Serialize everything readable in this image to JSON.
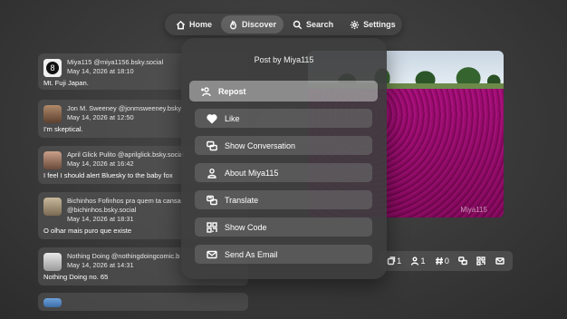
{
  "nav": {
    "items": [
      {
        "label": "Home",
        "icon": "home-icon"
      },
      {
        "label": "Discover",
        "icon": "discover-icon"
      },
      {
        "label": "Search",
        "icon": "search-icon"
      },
      {
        "label": "Settings",
        "icon": "gear-icon"
      }
    ],
    "active": "Discover"
  },
  "feed": {
    "posts": [
      {
        "author": "Miya115 @miya1156.bsky.social",
        "date": "May 14, 2026 at 18:10",
        "text": "Mt. Fuji  Japan."
      },
      {
        "author": "Jon M. Sweeney @jonmsweeney.bsky.",
        "date": "May 14, 2026 at 12:50",
        "text": "I'm skeptical."
      },
      {
        "author": "April Glick Pulito @aprilglick.bsky.social",
        "date": "May 14, 2026 at 16:42",
        "text": "I feel I should alert Bluesky to the baby fox"
      },
      {
        "author": "Bichinhos Fofinhos pra quem ta cansa",
        "handle": "@bichinhos.bsky.social",
        "date": "May 14, 2026 at 18:31",
        "text": "O olhar mais puro que existe"
      },
      {
        "author": "Nothing Doing @nothingdoingcomic.b",
        "date": "May 14, 2026 at 14:31",
        "text": "Nothing Doing no. 65"
      }
    ]
  },
  "photo": {
    "caption": "Miya115"
  },
  "actions": {
    "reposts": "1",
    "likes": "1",
    "tags": "0"
  },
  "menu": {
    "title": "Post by Miya115",
    "items": [
      {
        "label": "Repost",
        "icon": "repost-icon"
      },
      {
        "label": "Like",
        "icon": "heart-icon"
      },
      {
        "label": "Show Conversation",
        "icon": "conversation-icon"
      },
      {
        "label": "About Miya115",
        "icon": "person-icon"
      },
      {
        "label": "Translate",
        "icon": "translate-icon"
      },
      {
        "label": "Show Code",
        "icon": "qr-code-icon"
      },
      {
        "label": "Send As Email",
        "icon": "envelope-icon"
      }
    ]
  },
  "colors": {
    "background": "#3a3a3a",
    "menu": "#3e3e3e",
    "flowers": "#c233a5"
  }
}
